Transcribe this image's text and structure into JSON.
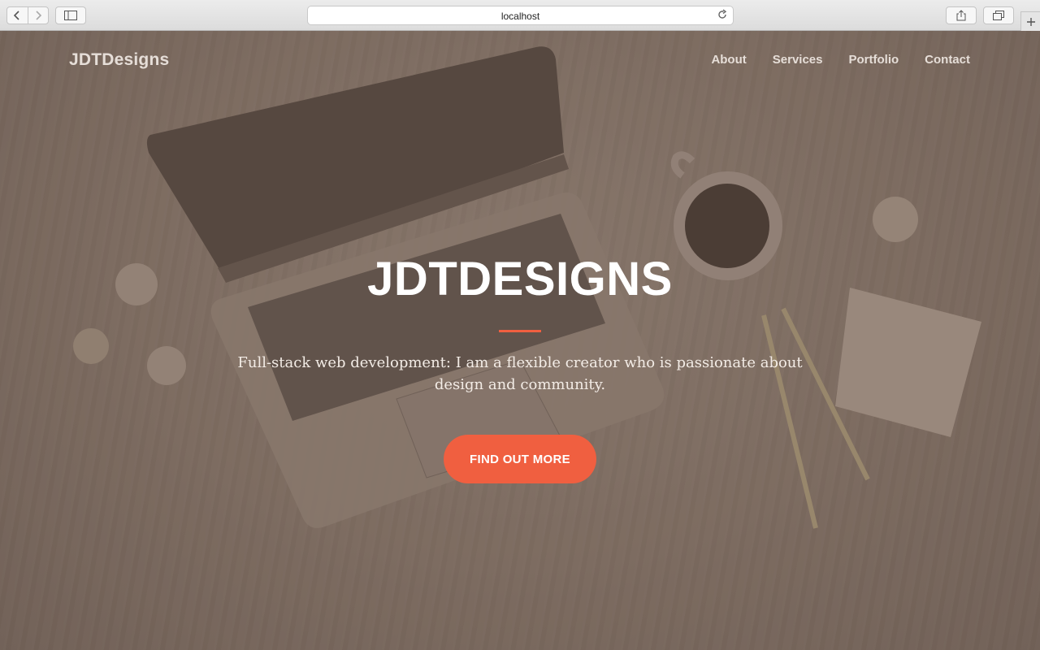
{
  "browser": {
    "url": "localhost",
    "icons": {
      "back": "chevron-left-icon",
      "forward": "chevron-right-icon",
      "sidebar": "sidebar-icon",
      "reload": "reload-icon",
      "share": "share-icon",
      "tabs": "tabs-icon",
      "new_tab": "plus-icon"
    }
  },
  "navbar": {
    "brand": "JDTDesigns",
    "links": [
      {
        "label": "About"
      },
      {
        "label": "Services"
      },
      {
        "label": "Portfolio"
      },
      {
        "label": "Contact"
      }
    ]
  },
  "hero": {
    "title": "JDTDESIGNS",
    "subtitle": "Full-stack web development: I am a flexible creator who is passionate about design and community.",
    "cta_label": "FIND OUT MORE"
  },
  "colors": {
    "accent": "#f05f40",
    "overlay": "#7a6a5f",
    "text_light": "#ffffff"
  }
}
